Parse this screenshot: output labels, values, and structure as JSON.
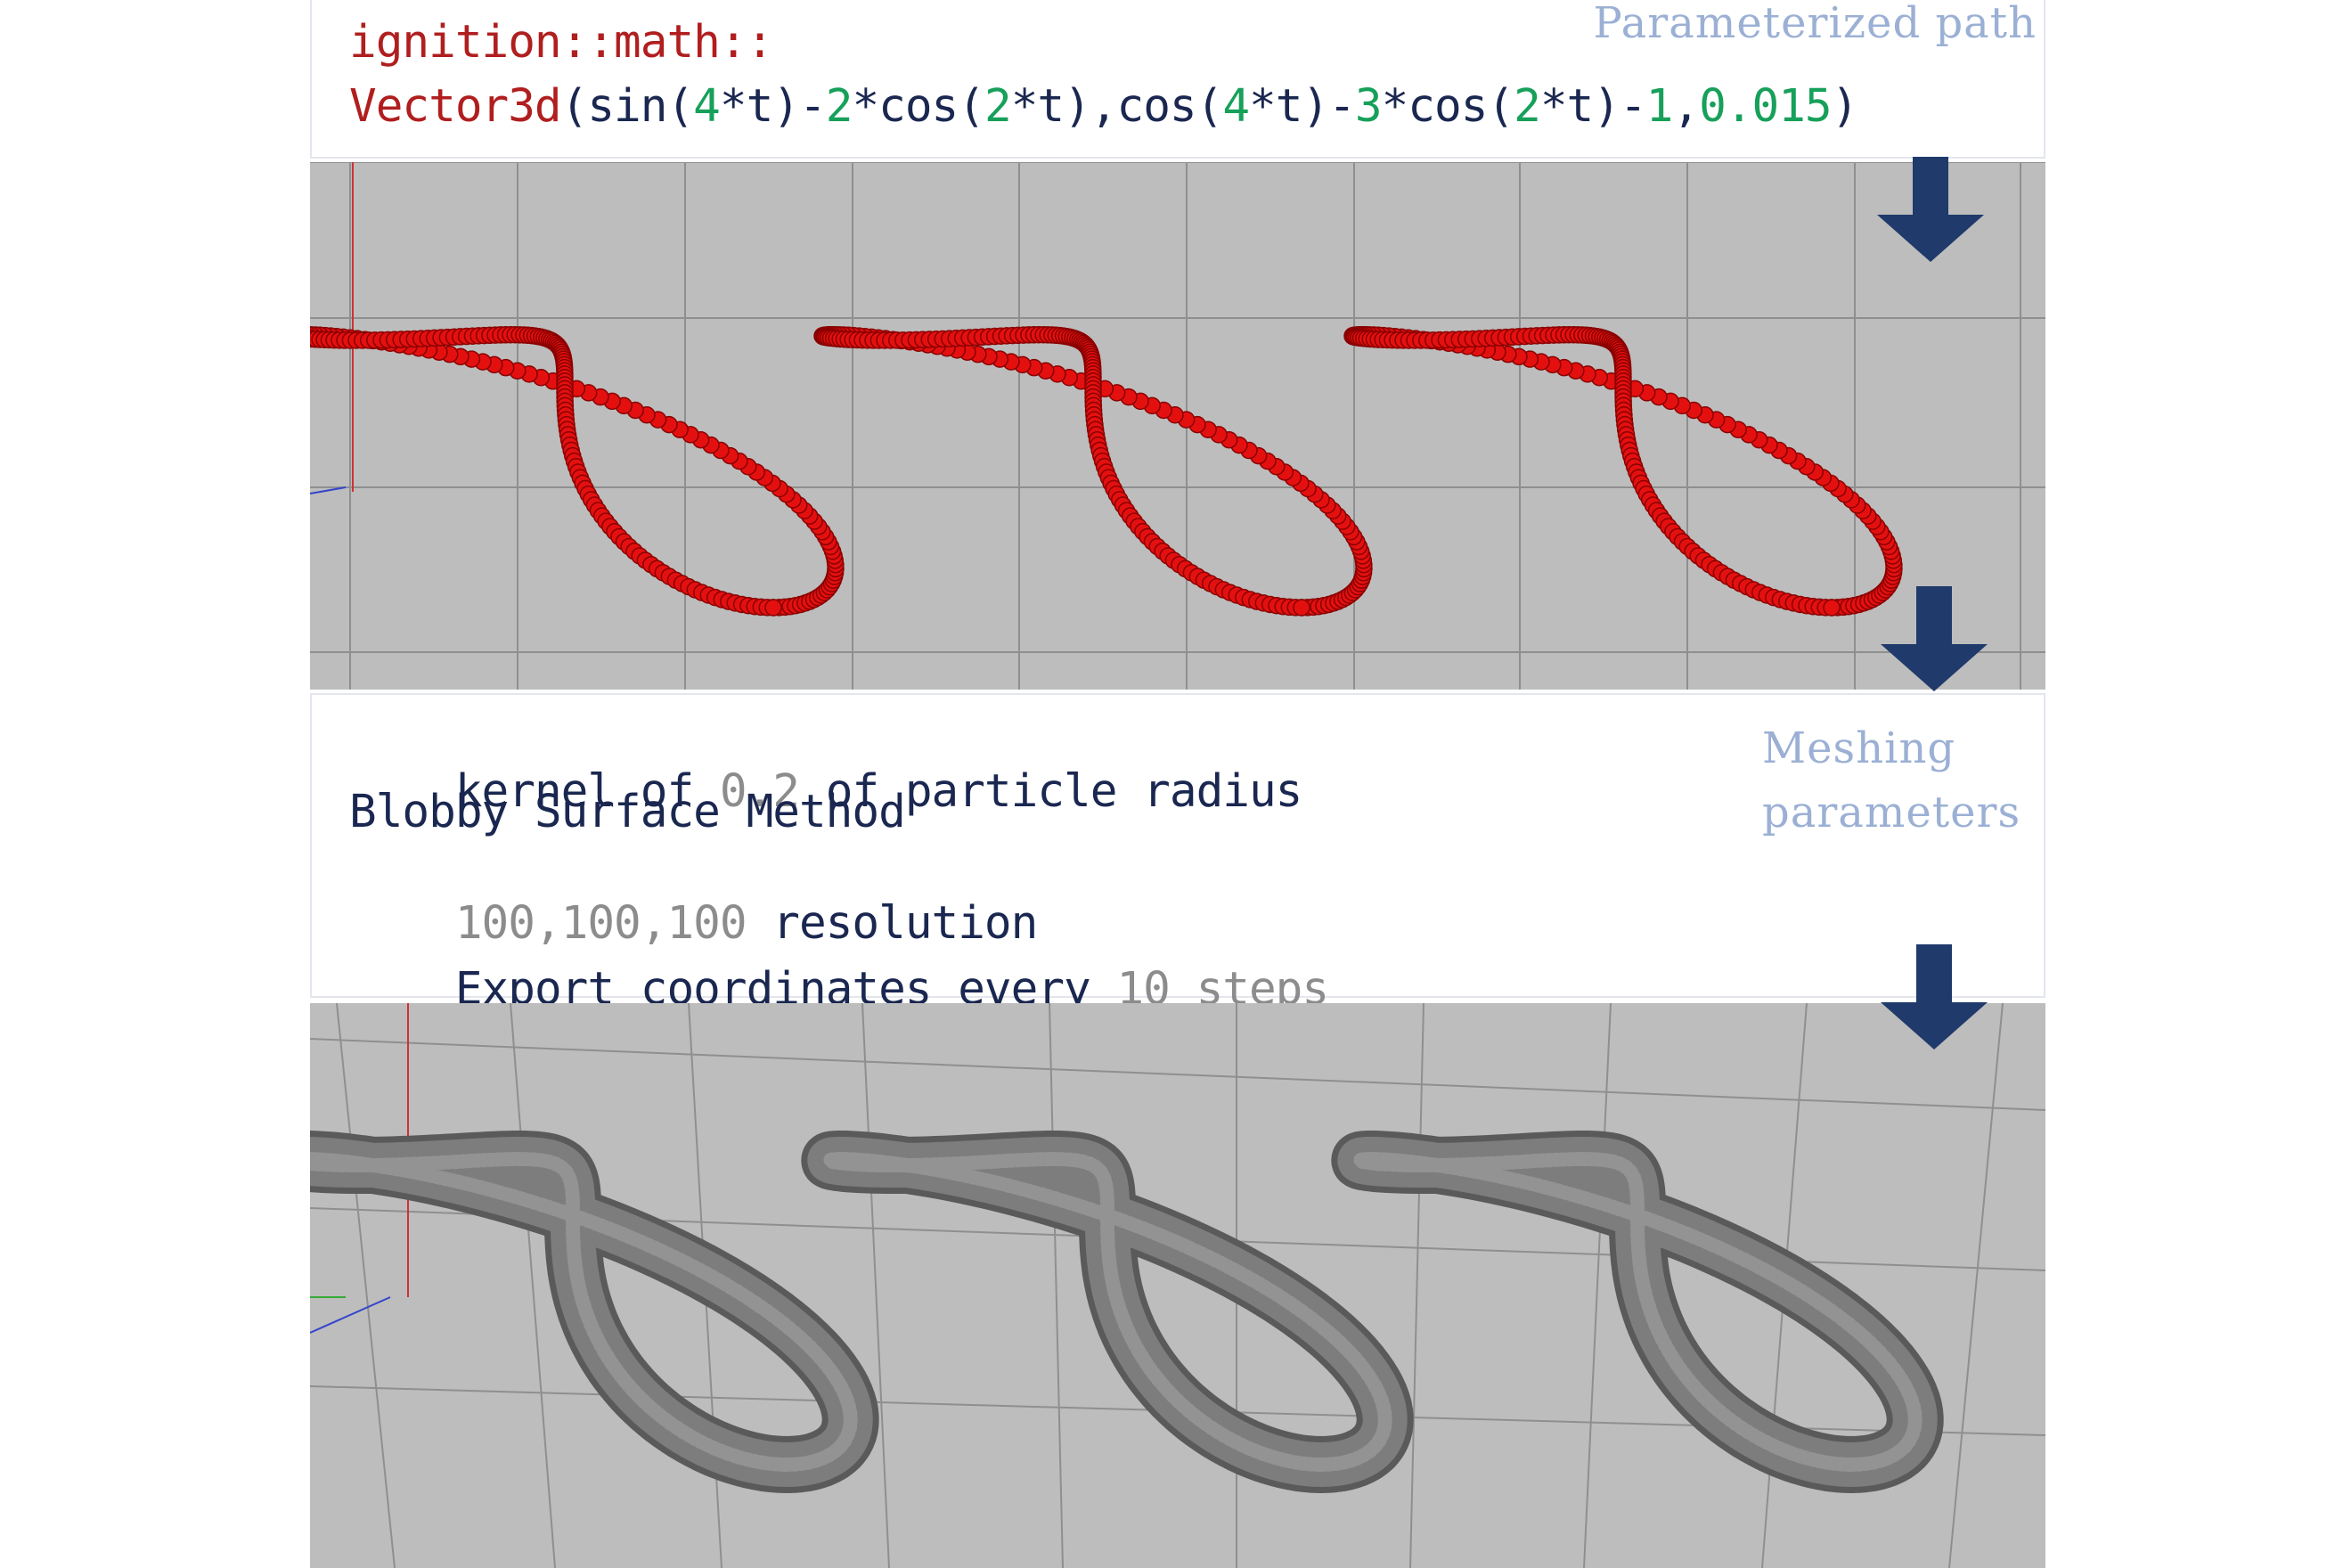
{
  "code": {
    "namespace": "ignition::math::",
    "parts": [
      {
        "text": "Vector3d",
        "color": "red"
      },
      {
        "text": "(sin(",
        "color": "navy"
      },
      {
        "text": "4",
        "color": "green"
      },
      {
        "text": "*t)-",
        "color": "navy"
      },
      {
        "text": "2",
        "color": "green"
      },
      {
        "text": "*cos(",
        "color": "navy"
      },
      {
        "text": "2",
        "color": "green"
      },
      {
        "text": "*t),cos(",
        "color": "navy"
      },
      {
        "text": "4",
        "color": "green"
      },
      {
        "text": "*t)-",
        "color": "navy"
      },
      {
        "text": "3",
        "color": "green"
      },
      {
        "text": "*cos(",
        "color": "navy"
      },
      {
        "text": "2",
        "color": "green"
      },
      {
        "text": "*t)-",
        "color": "navy"
      },
      {
        "text": "1",
        "color": "green"
      },
      {
        "text": ",",
        "color": "navy"
      },
      {
        "text": "0.015",
        "color": "green"
      },
      {
        "text": ")",
        "color": "navy"
      }
    ]
  },
  "labels": {
    "path": "Parameterized path",
    "mesh_line1": "Meshing",
    "mesh_line2": "parameters"
  },
  "meshing": {
    "line1": {
      "a": "kernel of ",
      "b": "0.2",
      "c": " of particle radius"
    },
    "line2": "Blobby Surface Method",
    "line3": {
      "a": "100,100,100",
      "b": " resolution"
    },
    "line4": {
      "a": "Export coordinates every ",
      "b": "10 steps"
    }
  },
  "colors": {
    "code_red": "#b01e1e",
    "code_green": "#17a05a",
    "text_navy": "#1a2750",
    "value_grey": "#8c8c8c",
    "label_blue": "#9bb0d4",
    "arrow_navy": "#1f3a6b",
    "viewport_bg": "#bdbdbd",
    "particle_red": "#e41010",
    "mesh_grey": "#7a7a7a"
  },
  "icons": {
    "arrow": "arrow-down-icon"
  }
}
